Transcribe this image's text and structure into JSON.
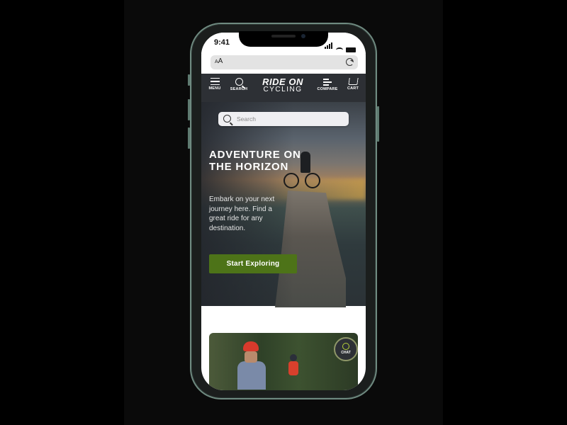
{
  "status_bar": {
    "time": "9:41"
  },
  "browser": {
    "text_size_label": "AA",
    "reload_icon": "reload-icon"
  },
  "nav": {
    "menu_label": "MENU",
    "search_label": "SEARCH",
    "logo_line1": "RIDE ON",
    "logo_line2": "CYCLING",
    "compare_label": "COMPARE",
    "cart_label": "CART"
  },
  "hero": {
    "search_placeholder": "Search",
    "search_value": "",
    "title": "ADVENTURE ON THE HORIZON",
    "description": "Embark on your next journey here. Find a great ride for any destination.",
    "cta_label": "Start Exploring",
    "cta_color": "#4d7318"
  },
  "chat": {
    "label": "CHAT",
    "accent": "#b6d23a"
  }
}
